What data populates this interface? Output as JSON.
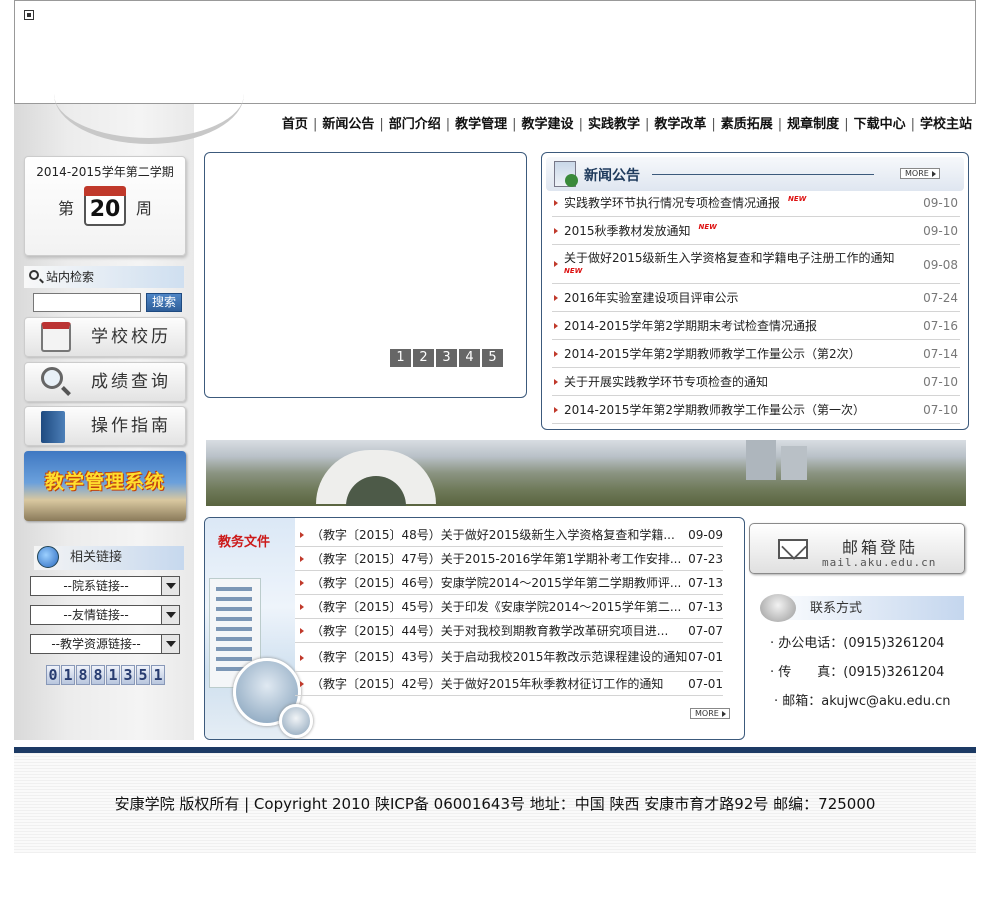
{
  "nav": {
    "items": [
      "首页",
      "新闻公告",
      "部门介绍",
      "教学管理",
      "教学建设",
      "实践教学",
      "教学改革",
      "素质拓展",
      "规章制度",
      "下载中心",
      "学校主站"
    ],
    "separator": "|"
  },
  "week": {
    "term": "2014-2015学年第二学期",
    "prefix": "第",
    "number": "20",
    "suffix": "周"
  },
  "search": {
    "title": "站内检索",
    "placeholder": "",
    "button": "搜索"
  },
  "side_buttons": {
    "calendar": "学校校历",
    "grades": "成绩查询",
    "guide": "操作指南"
  },
  "mgmt_banner": "教学管理系统",
  "links": {
    "title": "相关链接",
    "selects": [
      "--院系链接--",
      "--友情链接--",
      "--教学资源链接--"
    ]
  },
  "counter": [
    "0",
    "1",
    "8",
    "8",
    "1",
    "3",
    "5",
    "1"
  ],
  "slider": {
    "pages": [
      "1",
      "2",
      "3",
      "4",
      "5"
    ]
  },
  "news": {
    "title": "新闻公告",
    "more": "MORE",
    "new_label": "NEW",
    "items": [
      {
        "text": "实践教学环节执行情况专项检查情况通报",
        "date": "09-10",
        "is_new": true
      },
      {
        "text": "2015秋季教材发放通知",
        "date": "09-10",
        "is_new": true
      },
      {
        "text": "关于做好2015级新生入学资格复查和学籍电子注册工作的通知",
        "date": "09-08",
        "is_new": true
      },
      {
        "text": "2016年实验室建设项目评审公示",
        "date": "07-24",
        "is_new": false
      },
      {
        "text": "2014-2015学年第2学期期末考试检查情况通报",
        "date": "07-16",
        "is_new": false
      },
      {
        "text": "2014-2015学年第2学期教师教学工作量公示（第2次）",
        "date": "07-14",
        "is_new": false
      },
      {
        "text": "关于开展实践教学环节专项检查的通知",
        "date": "07-10",
        "is_new": false
      },
      {
        "text": "2014-2015学年第2学期教师教学工作量公示（第一次）",
        "date": "07-10",
        "is_new": false
      }
    ]
  },
  "docs": {
    "title": "教务文件",
    "more": "MORE",
    "items": [
      {
        "text": "（教字〔2015〕48号）关于做好2015级新生入学资格复查和学籍...",
        "date": "09-09"
      },
      {
        "text": "（教字〔2015〕47号）关于2015-2016学年第1学期补考工作安排...",
        "date": "07-23"
      },
      {
        "text": "（教字〔2015〕46号）安康学院2014～2015学年第二学期教师评...",
        "date": "07-13"
      },
      {
        "text": "（教字〔2015〕45号）关于印发《安康学院2014～2015学年第二...",
        "date": "07-13"
      },
      {
        "text": "（教字〔2015〕44号）关于对我校到期教育教学改革研究项目进...",
        "date": "07-07"
      },
      {
        "text": "（教字〔2015〕43号）关于启动我校2015年教改示范课程建设的通知",
        "date": "07-01"
      },
      {
        "text": "（教字〔2015〕42号）关于做好2015年秋季教材征订工作的通知",
        "date": "07-01"
      }
    ]
  },
  "mail": {
    "title": "邮箱登陆",
    "subtitle": "mail.aku.edu.cn"
  },
  "contact": {
    "title": "联系方式",
    "phone": "· 办公电话：(0915)3261204",
    "fax": "· 传　　真：(0915)3261204",
    "email": "· 邮箱：akujwc@aku.edu.cn"
  },
  "footer": {
    "text": "安康学院 版权所有 | Copyright 2010 陕ICP备 06001643号  地址：中国 陕西 安康市育才路92号 邮编：725000"
  },
  "colors": {
    "accent": "#1c3a64",
    "border": "#3c5a7c",
    "news_title": "#1e3a5c",
    "docs_title": "#cc1a1a",
    "new_tag": "#d11111"
  }
}
